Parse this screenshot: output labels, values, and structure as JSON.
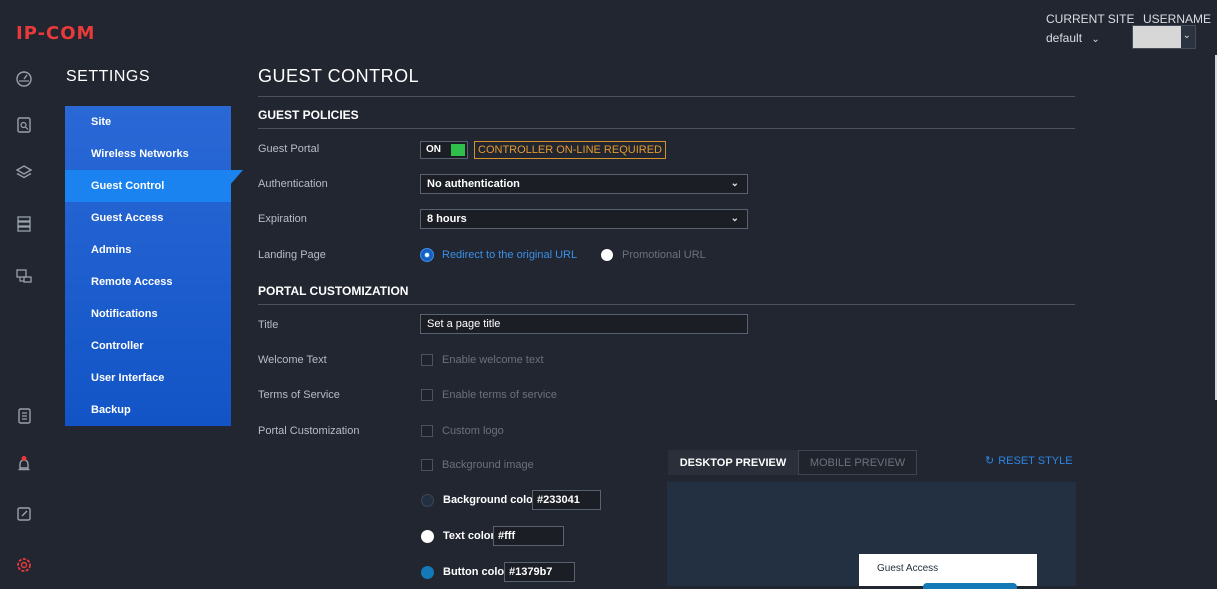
{
  "brand": {
    "logo": "IP-COM"
  },
  "header": {
    "current_site_label": "CURRENT SITE",
    "current_site_value": "default",
    "username_label": "USERNAME"
  },
  "settings_nav": {
    "title": "SETTINGS",
    "items": [
      {
        "label": "Site"
      },
      {
        "label": "Wireless Networks"
      },
      {
        "label": "Guest Control"
      },
      {
        "label": "Guest Access"
      },
      {
        "label": "Admins"
      },
      {
        "label": "Remote Access"
      },
      {
        "label": "Notifications"
      },
      {
        "label": "Controller"
      },
      {
        "label": "User Interface"
      },
      {
        "label": "Backup"
      }
    ],
    "active": "Guest Control"
  },
  "sidebar_icons": [
    "dashboard-icon",
    "statistics-icon",
    "layers-icon",
    "devices-icon",
    "topology-icon",
    "logs-icon",
    "alerts-icon",
    "edit-icon",
    "settings-icon"
  ],
  "page": {
    "title": "GUEST CONTROL",
    "guest_policies": {
      "heading": "GUEST POLICIES",
      "guest_portal_label": "Guest Portal",
      "guest_portal_toggle": "ON",
      "controller_badge": "CONTROLLER ON-LINE REQUIRED",
      "authentication_label": "Authentication",
      "authentication_value": "No authentication",
      "expiration_label": "Expiration",
      "expiration_value": "8 hours",
      "landing_page_label": "Landing Page",
      "landing_options": [
        "Redirect to the original URL",
        "Promotional URL"
      ],
      "landing_selected": "Redirect to the original URL"
    },
    "portal_customization": {
      "heading": "PORTAL CUSTOMIZATION",
      "title_label": "Title",
      "title_placeholder": "Set a page title",
      "welcome_label": "Welcome Text",
      "welcome_checkbox": "Enable welcome text",
      "terms_label": "Terms of Service",
      "terms_checkbox": "Enable terms of service",
      "portal_label": "Portal Customization",
      "custom_logo_checkbox": "Custom logo",
      "background_image_checkbox": "Background image",
      "background_color_label": "Background color",
      "background_color_value": "#233041",
      "text_color_label": "Text color",
      "text_color_value": "#fff",
      "button_color_label": "Button color",
      "button_color_value": "#1379b7"
    },
    "preview": {
      "tabs": [
        "DESKTOP PREVIEW",
        "MOBILE PREVIEW"
      ],
      "active_tab": "DESKTOP PREVIEW",
      "reset_label": "RESET STYLE",
      "card_title": "Guest Access"
    }
  },
  "colors": {
    "accent": "#1a83f0",
    "badge": "#e49a2e",
    "toggle_on": "#2fbf4b",
    "brand_red": "#e83a3a"
  }
}
